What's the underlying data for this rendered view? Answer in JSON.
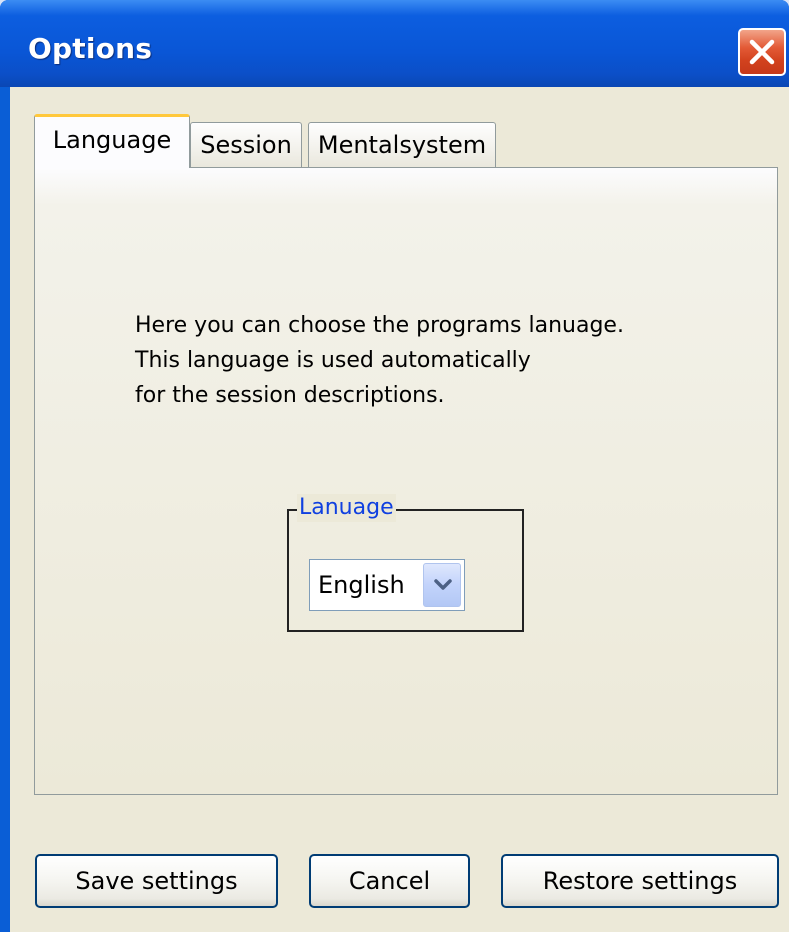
{
  "window": {
    "title": "Options",
    "close_icon": "close-icon"
  },
  "tabs": [
    {
      "label": "Language",
      "active": true
    },
    {
      "label": "Session",
      "active": false
    },
    {
      "label": "Mentalsystem",
      "active": false
    }
  ],
  "language_tab": {
    "description_lines": [
      "Here you can choose the programs lanuage.",
      "This language is used automatically",
      "for the session descriptions."
    ],
    "group_label": "Lanuage",
    "language_select": {
      "value": "English"
    }
  },
  "buttons": {
    "save": "Save settings",
    "cancel": "Cancel",
    "restore": "Restore settings"
  },
  "colors": {
    "titlebar": "#0a56d6",
    "close_button": "#d2421e",
    "active_tab_highlight": "#ffc83c",
    "group_label": "#1040e0",
    "dialog_background": "#ece9d8"
  }
}
